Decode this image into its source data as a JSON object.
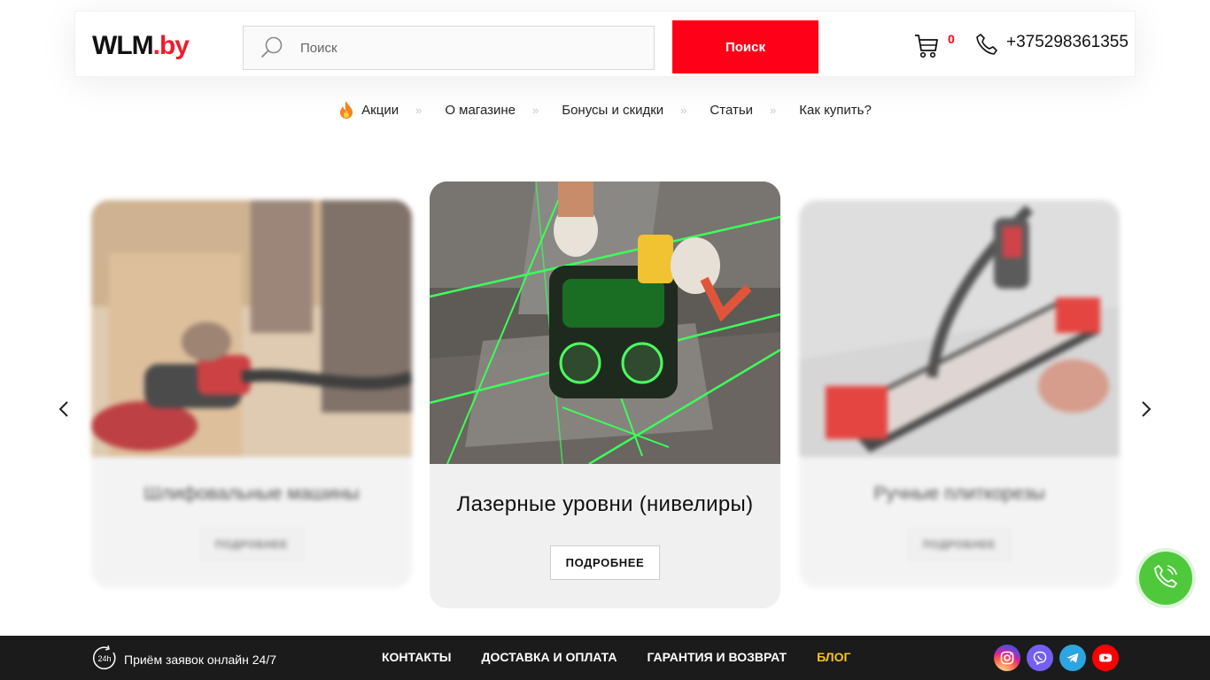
{
  "header": {
    "logo_main": "WLM",
    "logo_domain": ".by",
    "search_placeholder": "Поиск",
    "search_button": "Поиск",
    "cart_count": "0",
    "phone": "+375298361355"
  },
  "nav": {
    "items": [
      {
        "label": "Акции",
        "icon": "fire-icon"
      },
      {
        "label": "О магазине"
      },
      {
        "label": "Бонусы и скидки"
      },
      {
        "label": "Статьи"
      },
      {
        "label": "Как купить?"
      }
    ],
    "separator": "»"
  },
  "slider": {
    "left": {
      "title": "Шлифовальные машины",
      "button": "ПОДРОБНЕЕ"
    },
    "center": {
      "title": "Лазерные уровни (нивелиры)",
      "button": "ПОДРОБНЕЕ"
    },
    "right": {
      "title": "Ручные плиткорезы",
      "button": "ПОДРОБНЕЕ"
    }
  },
  "footer": {
    "online_text": "Приём заявок онлайн 24/7",
    "badge_24h": "24h",
    "links": [
      "КОНТАКТЫ",
      "ДОСТАВКА И ОПЛАТА",
      "ГАРАНТИЯ И ВОЗВРАТ",
      "БЛОГ"
    ],
    "socials": [
      "instagram-icon",
      "viber-icon",
      "telegram-icon",
      "youtube-icon"
    ]
  },
  "colors": {
    "brand_red": "#ff0019",
    "footer_bg": "#1b1b1b",
    "blog_yellow": "#f5c518",
    "call_green": "#4fc93b"
  }
}
